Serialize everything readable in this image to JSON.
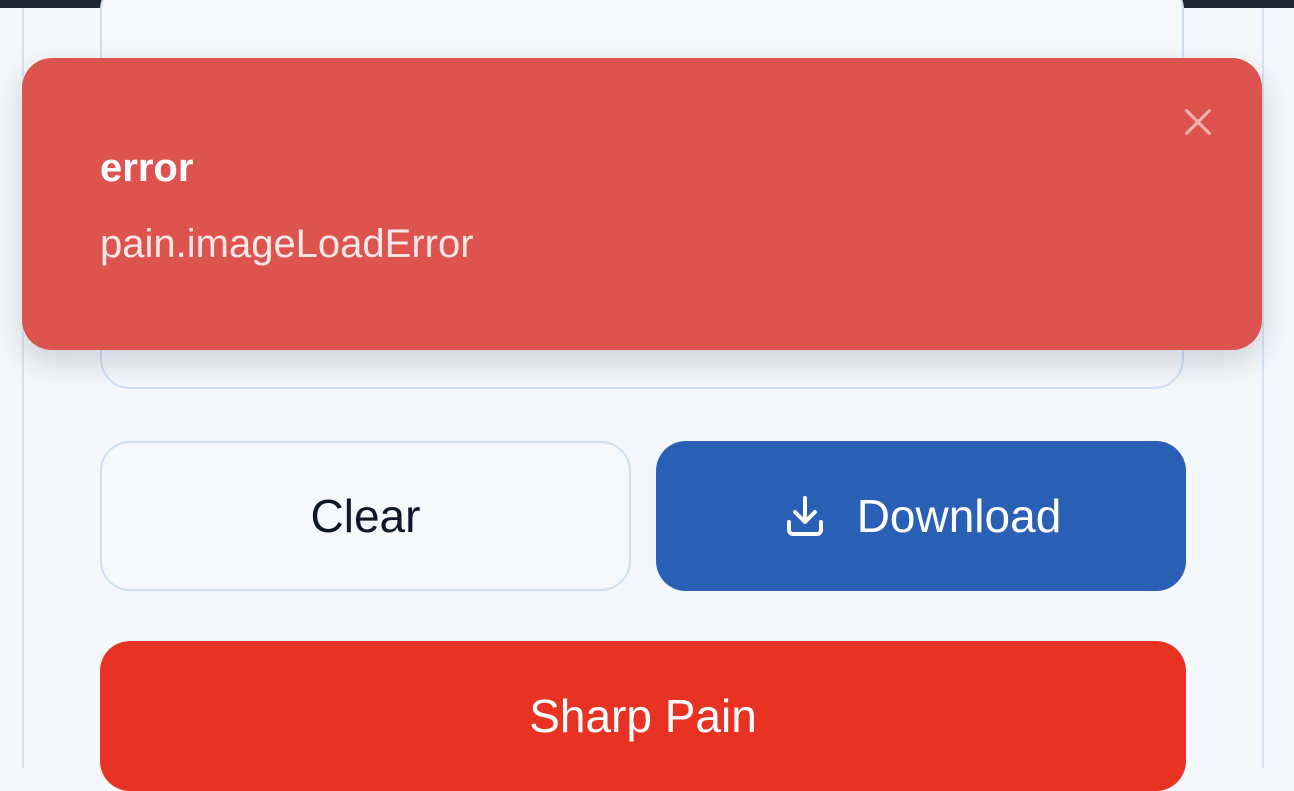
{
  "toast": {
    "title": "error",
    "message": "pain.imageLoadError",
    "close_icon": "close-icon",
    "background": "#dd544e"
  },
  "actions": {
    "clear_label": "Clear",
    "download_label": "Download",
    "download_icon": "download-icon",
    "download_color": "#295fb5"
  },
  "pain_button": {
    "label": "Sharp Pain",
    "color": "#e83324"
  }
}
